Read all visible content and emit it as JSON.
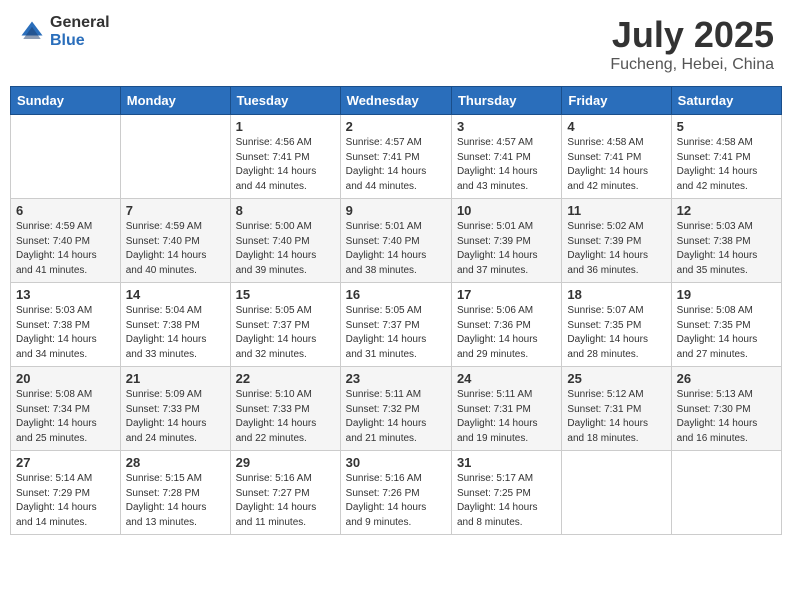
{
  "header": {
    "logo_general": "General",
    "logo_blue": "Blue",
    "month_year": "July 2025",
    "location": "Fucheng, Hebei, China"
  },
  "weekdays": [
    "Sunday",
    "Monday",
    "Tuesday",
    "Wednesday",
    "Thursday",
    "Friday",
    "Saturday"
  ],
  "weeks": [
    [
      {
        "day": "",
        "info": ""
      },
      {
        "day": "",
        "info": ""
      },
      {
        "day": "1",
        "info": "Sunrise: 4:56 AM\nSunset: 7:41 PM\nDaylight: 14 hours\nand 44 minutes."
      },
      {
        "day": "2",
        "info": "Sunrise: 4:57 AM\nSunset: 7:41 PM\nDaylight: 14 hours\nand 44 minutes."
      },
      {
        "day": "3",
        "info": "Sunrise: 4:57 AM\nSunset: 7:41 PM\nDaylight: 14 hours\nand 43 minutes."
      },
      {
        "day": "4",
        "info": "Sunrise: 4:58 AM\nSunset: 7:41 PM\nDaylight: 14 hours\nand 42 minutes."
      },
      {
        "day": "5",
        "info": "Sunrise: 4:58 AM\nSunset: 7:41 PM\nDaylight: 14 hours\nand 42 minutes."
      }
    ],
    [
      {
        "day": "6",
        "info": "Sunrise: 4:59 AM\nSunset: 7:40 PM\nDaylight: 14 hours\nand 41 minutes."
      },
      {
        "day": "7",
        "info": "Sunrise: 4:59 AM\nSunset: 7:40 PM\nDaylight: 14 hours\nand 40 minutes."
      },
      {
        "day": "8",
        "info": "Sunrise: 5:00 AM\nSunset: 7:40 PM\nDaylight: 14 hours\nand 39 minutes."
      },
      {
        "day": "9",
        "info": "Sunrise: 5:01 AM\nSunset: 7:40 PM\nDaylight: 14 hours\nand 38 minutes."
      },
      {
        "day": "10",
        "info": "Sunrise: 5:01 AM\nSunset: 7:39 PM\nDaylight: 14 hours\nand 37 minutes."
      },
      {
        "day": "11",
        "info": "Sunrise: 5:02 AM\nSunset: 7:39 PM\nDaylight: 14 hours\nand 36 minutes."
      },
      {
        "day": "12",
        "info": "Sunrise: 5:03 AM\nSunset: 7:38 PM\nDaylight: 14 hours\nand 35 minutes."
      }
    ],
    [
      {
        "day": "13",
        "info": "Sunrise: 5:03 AM\nSunset: 7:38 PM\nDaylight: 14 hours\nand 34 minutes."
      },
      {
        "day": "14",
        "info": "Sunrise: 5:04 AM\nSunset: 7:38 PM\nDaylight: 14 hours\nand 33 minutes."
      },
      {
        "day": "15",
        "info": "Sunrise: 5:05 AM\nSunset: 7:37 PM\nDaylight: 14 hours\nand 32 minutes."
      },
      {
        "day": "16",
        "info": "Sunrise: 5:05 AM\nSunset: 7:37 PM\nDaylight: 14 hours\nand 31 minutes."
      },
      {
        "day": "17",
        "info": "Sunrise: 5:06 AM\nSunset: 7:36 PM\nDaylight: 14 hours\nand 29 minutes."
      },
      {
        "day": "18",
        "info": "Sunrise: 5:07 AM\nSunset: 7:35 PM\nDaylight: 14 hours\nand 28 minutes."
      },
      {
        "day": "19",
        "info": "Sunrise: 5:08 AM\nSunset: 7:35 PM\nDaylight: 14 hours\nand 27 minutes."
      }
    ],
    [
      {
        "day": "20",
        "info": "Sunrise: 5:08 AM\nSunset: 7:34 PM\nDaylight: 14 hours\nand 25 minutes."
      },
      {
        "day": "21",
        "info": "Sunrise: 5:09 AM\nSunset: 7:33 PM\nDaylight: 14 hours\nand 24 minutes."
      },
      {
        "day": "22",
        "info": "Sunrise: 5:10 AM\nSunset: 7:33 PM\nDaylight: 14 hours\nand 22 minutes."
      },
      {
        "day": "23",
        "info": "Sunrise: 5:11 AM\nSunset: 7:32 PM\nDaylight: 14 hours\nand 21 minutes."
      },
      {
        "day": "24",
        "info": "Sunrise: 5:11 AM\nSunset: 7:31 PM\nDaylight: 14 hours\nand 19 minutes."
      },
      {
        "day": "25",
        "info": "Sunrise: 5:12 AM\nSunset: 7:31 PM\nDaylight: 14 hours\nand 18 minutes."
      },
      {
        "day": "26",
        "info": "Sunrise: 5:13 AM\nSunset: 7:30 PM\nDaylight: 14 hours\nand 16 minutes."
      }
    ],
    [
      {
        "day": "27",
        "info": "Sunrise: 5:14 AM\nSunset: 7:29 PM\nDaylight: 14 hours\nand 14 minutes."
      },
      {
        "day": "28",
        "info": "Sunrise: 5:15 AM\nSunset: 7:28 PM\nDaylight: 14 hours\nand 13 minutes."
      },
      {
        "day": "29",
        "info": "Sunrise: 5:16 AM\nSunset: 7:27 PM\nDaylight: 14 hours\nand 11 minutes."
      },
      {
        "day": "30",
        "info": "Sunrise: 5:16 AM\nSunset: 7:26 PM\nDaylight: 14 hours\nand 9 minutes."
      },
      {
        "day": "31",
        "info": "Sunrise: 5:17 AM\nSunset: 7:25 PM\nDaylight: 14 hours\nand 8 minutes."
      },
      {
        "day": "",
        "info": ""
      },
      {
        "day": "",
        "info": ""
      }
    ]
  ]
}
